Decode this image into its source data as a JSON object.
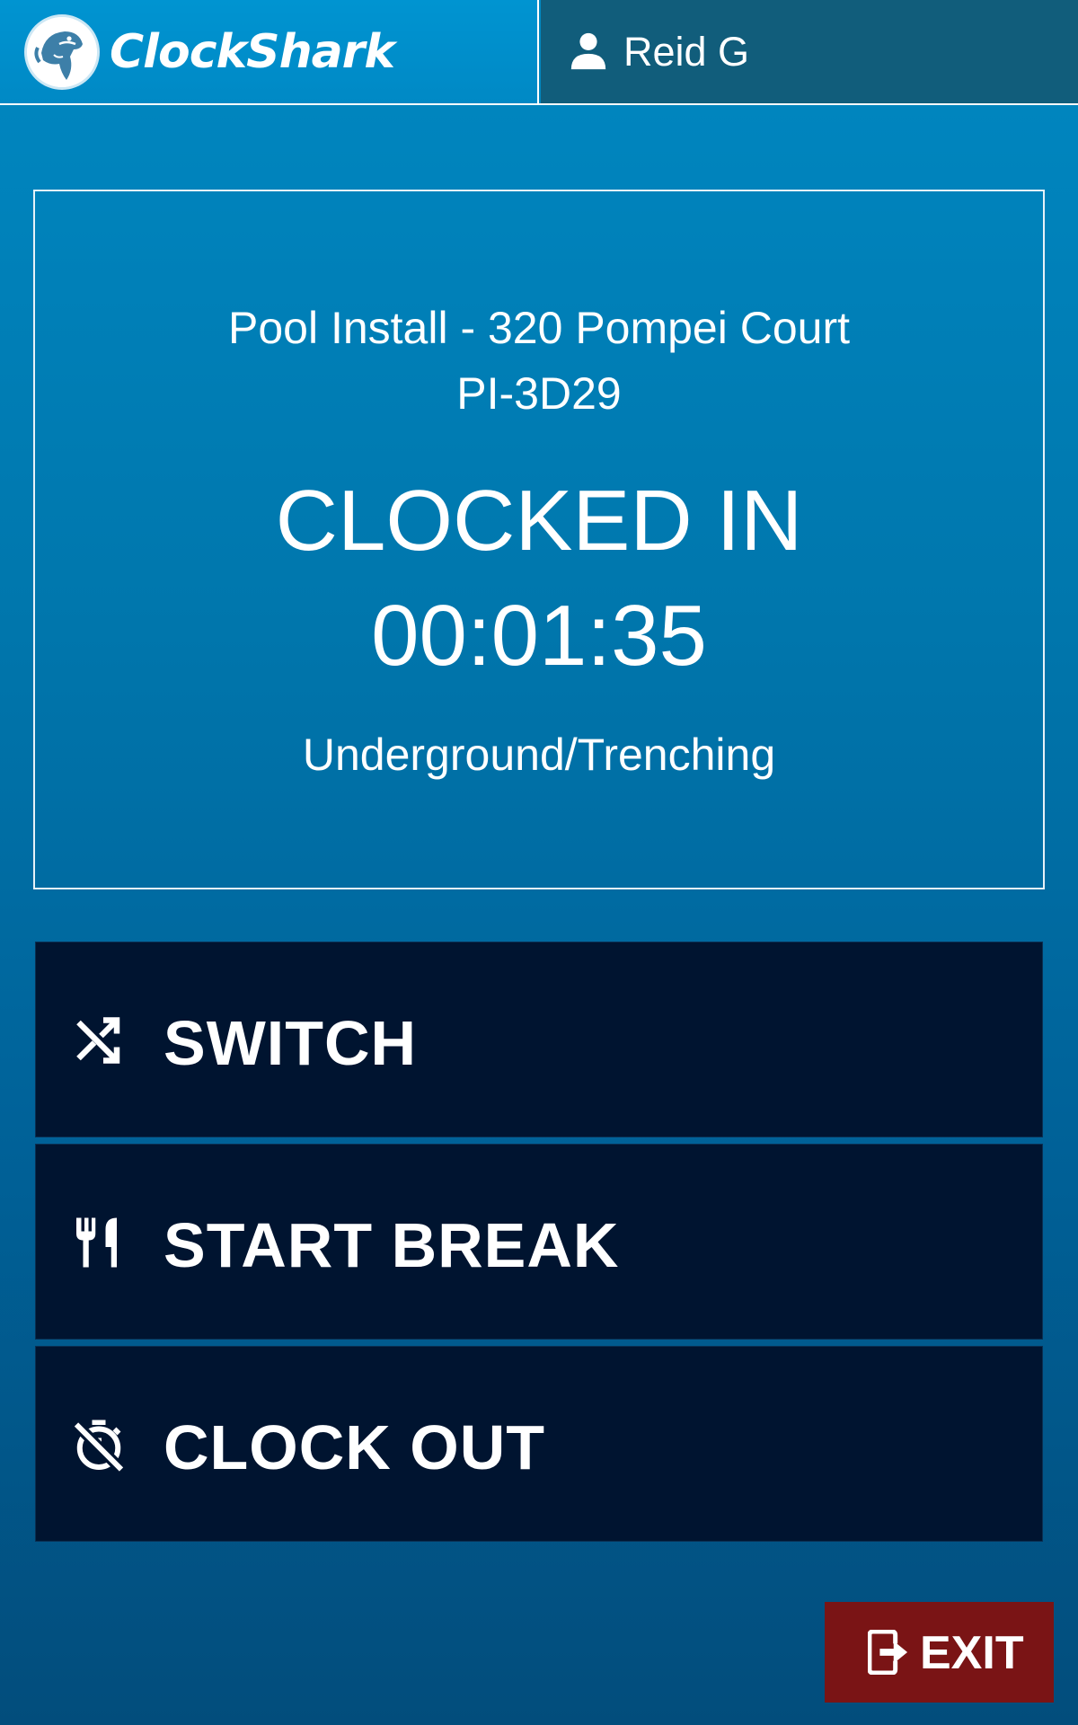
{
  "header": {
    "brand_name": "ClockShark",
    "user_name": "Reid G"
  },
  "status": {
    "job_name": "Pool Install - 320 Pompei Court",
    "job_code": "PI-3D29",
    "state": "CLOCKED IN",
    "elapsed": "00:01:35",
    "task": "Underground/Trenching"
  },
  "actions": {
    "switch_label": "SWITCH",
    "break_label": "START BREAK",
    "clock_out_label": "CLOCK OUT"
  },
  "exit": {
    "label": "EXIT"
  },
  "colors": {
    "header_brand_bg": "#0094d1",
    "header_user_bg": "#115d7b",
    "action_button_bg": "#001430",
    "exit_button_bg": "#7a1415",
    "text": "#ffffff"
  },
  "icons": {
    "logo": "shark-logo-icon",
    "user": "user-icon",
    "switch": "shuffle-icon",
    "break": "fork-knife-icon",
    "clock_out": "timer-off-icon",
    "exit": "exit-icon"
  }
}
